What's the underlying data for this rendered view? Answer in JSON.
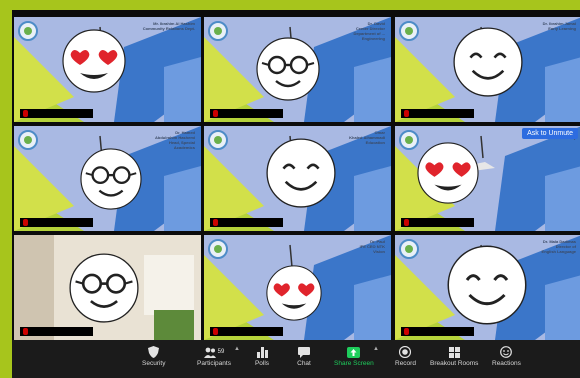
{
  "meeting": {
    "ask_unmute_label": "Ask to Unmute",
    "participant_count": "59"
  },
  "tiles": [
    {
      "name": "",
      "face": "heart-eyes",
      "slide_label": "Mr. Ibrahim Al Hashim\nCommunity Relations Dept.",
      "muted": true
    },
    {
      "name": "",
      "face": "glasses",
      "slide_label": "Dr. David\nCenter Director\nDepartment of ...\nEngineering",
      "muted": true,
      "active": true
    },
    {
      "name": "",
      "face": "smile",
      "slide_label": "Dr. Ibrahim Jamal\nEarly Learning",
      "muted": true
    },
    {
      "name": "",
      "face": "glasses",
      "slide_label": "Dr. Hamed\nAbdulrahim Hashemi\nHead, Special\nAcademics",
      "muted": true
    },
    {
      "name": "",
      "face": "smile",
      "slide_label": "Omar\nKhaled Alhammadi\nEducation",
      "muted": true
    },
    {
      "name": "",
      "face": "heart-eyes",
      "slide_label": "Dr. Henna\nConsultancy",
      "muted": true,
      "ask_unmute": true
    },
    {
      "name": "",
      "face": "glasses",
      "slide_label": "",
      "muted": true
    },
    {
      "name": "",
      "face": "heart-eyes",
      "slide_label": "Dr. Paul\nIFE CEO NTK\nVision",
      "muted": true
    },
    {
      "name": "",
      "face": "smile",
      "slide_label": "Dr. Mala Dadimas\nDirector of\nEnglish Language",
      "muted": true
    }
  ],
  "toolbar": {
    "security": "Security",
    "participants": "Participants",
    "polls": "Polls",
    "chat": "Chat",
    "share_screen": "Share Screen",
    "record": "Record",
    "breakout_rooms": "Breakout Rooms",
    "reactions": "Reactions"
  },
  "colors": {
    "outer_bg": "#a7c51c",
    "toolbar_bg": "#1b1b1b",
    "share_green": "#1ecd5c",
    "active_border": "#c8e23a",
    "unmute_blue": "#2d6ce0"
  }
}
